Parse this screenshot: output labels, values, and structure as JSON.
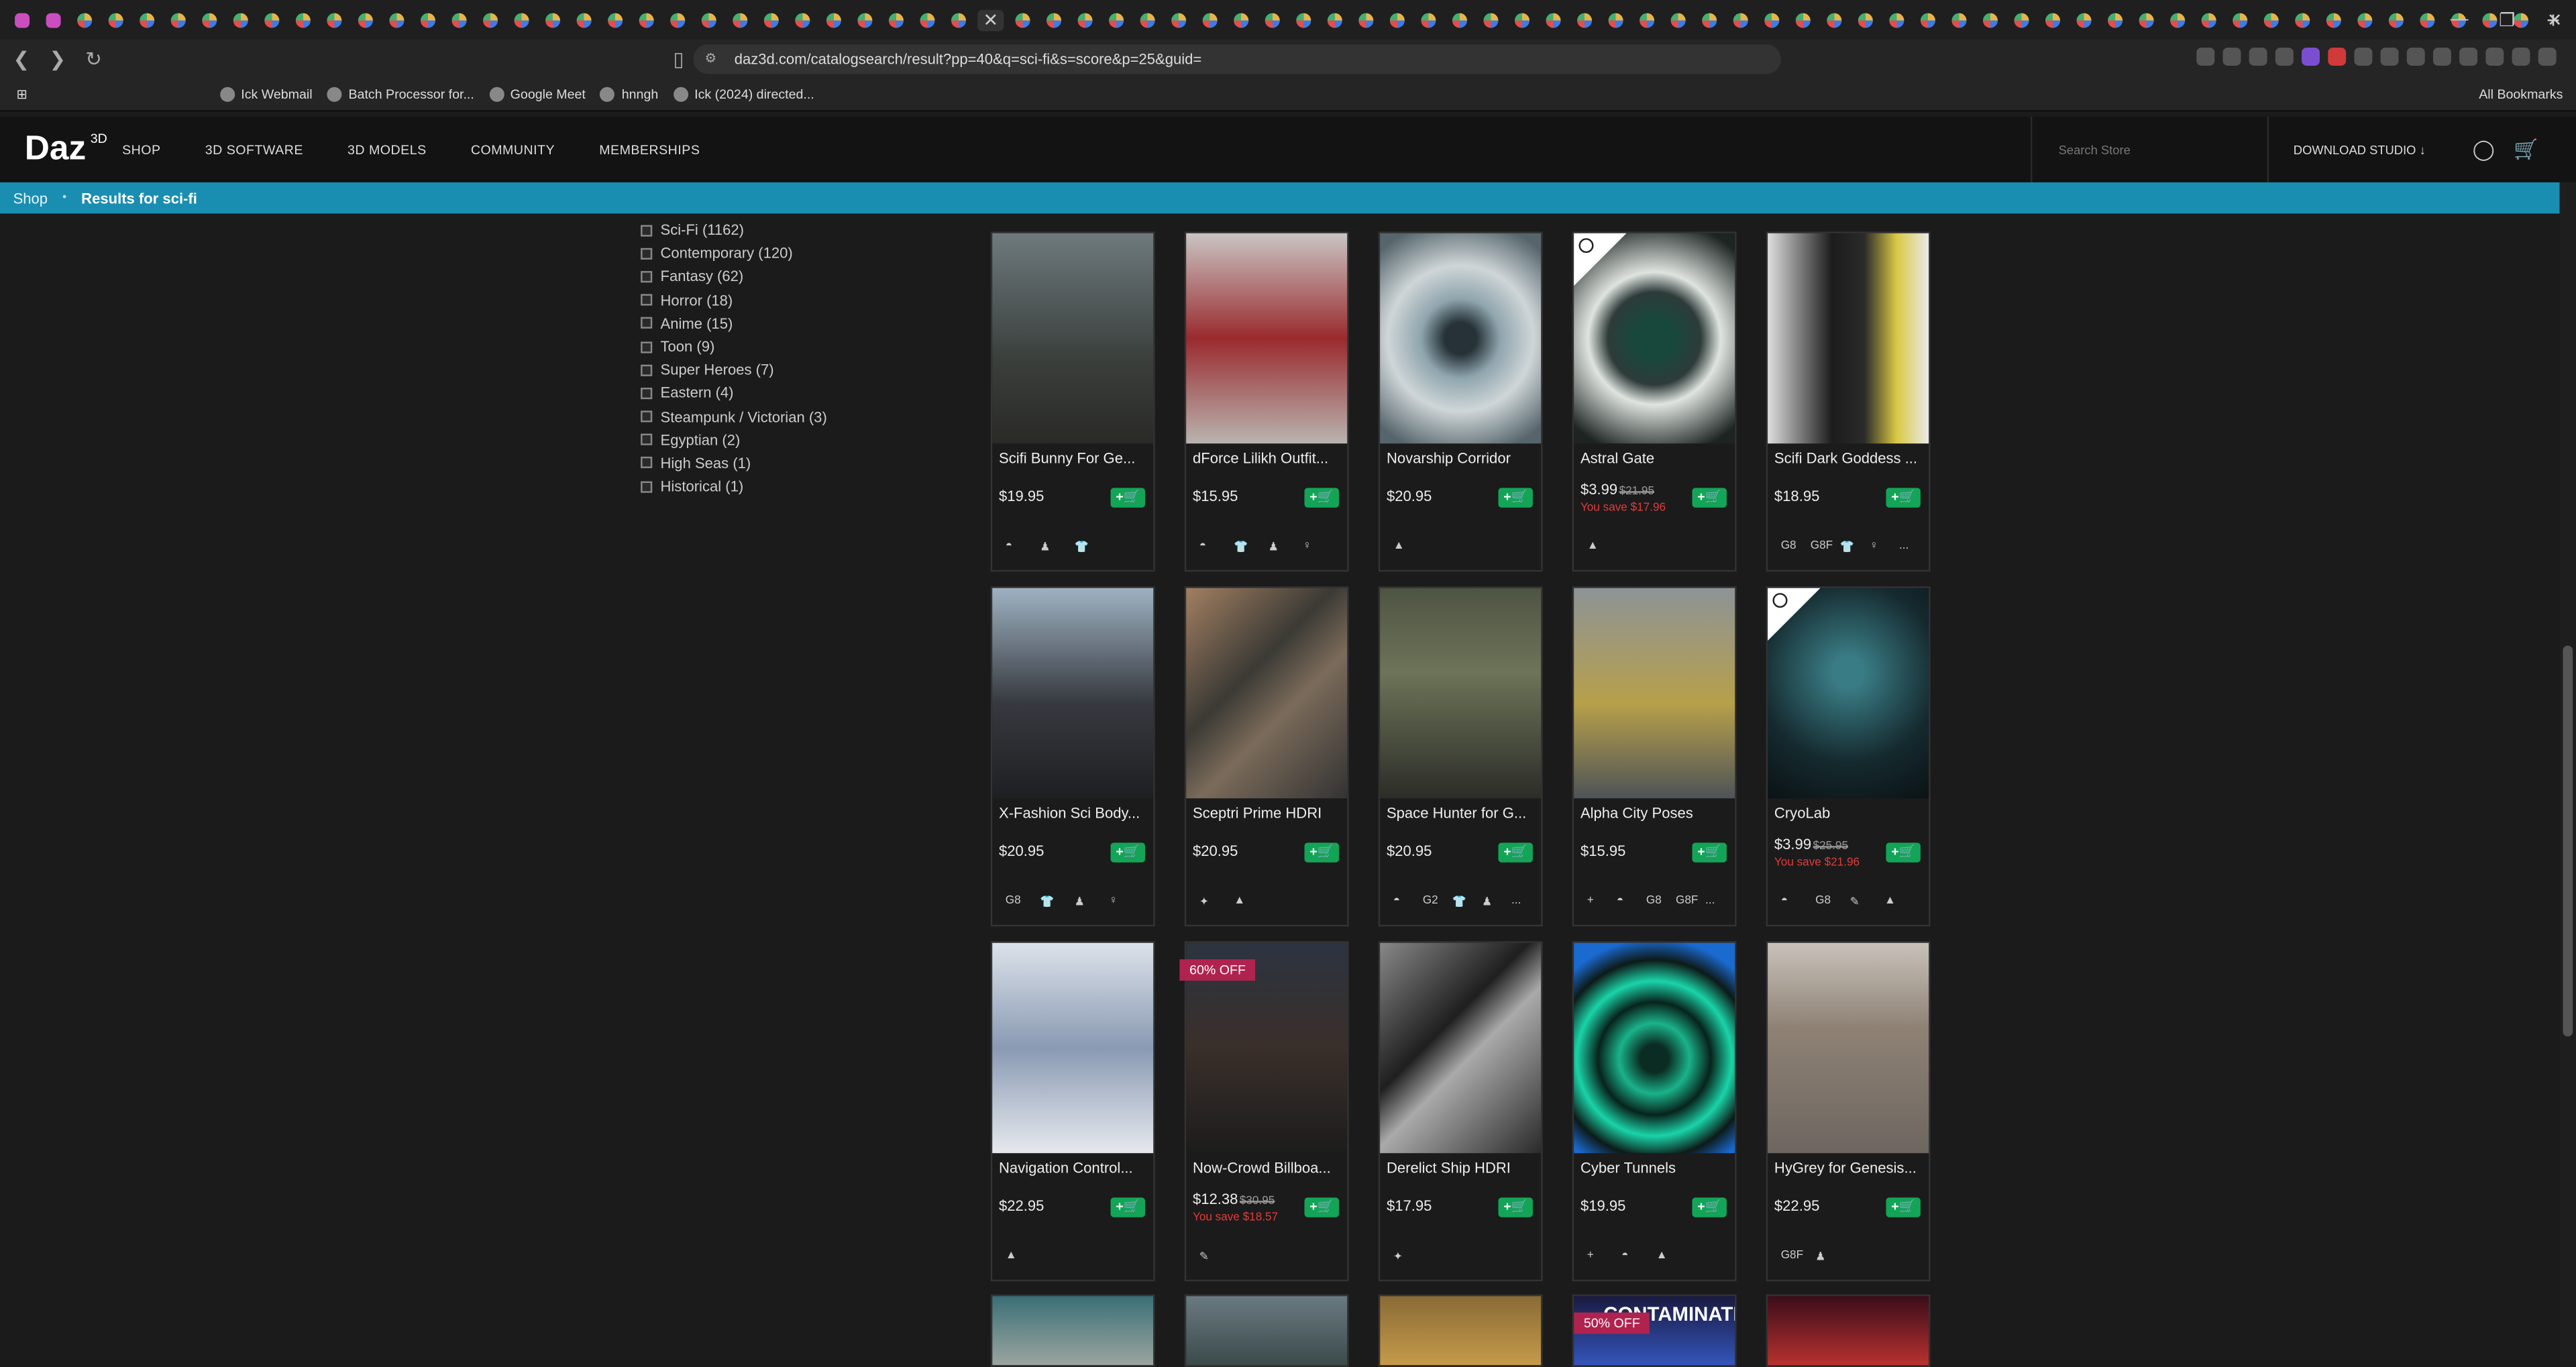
{
  "browser": {
    "url": "daz3d.com/catalogsearch/result?pp=40&q=sci-fi&s=score&p=25&guid=",
    "bookmarks": [
      "Ick Webmail",
      "Batch Processor for...",
      "Google Meet",
      "hnngh",
      "Ick (2024) directed..."
    ],
    "all_bookmarks": "All Bookmarks",
    "tab_close": "✕",
    "new_tab": "+"
  },
  "site": {
    "logo": "Daz",
    "logo_sup": "3D",
    "nav": [
      "SHOP",
      "3D SOFTWARE",
      "3D MODELS",
      "COMMUNITY",
      "MEMBERSHIPS"
    ],
    "search_placeholder": "Search Store",
    "download": "DOWNLOAD STUDIO ↓"
  },
  "breadcrumb": {
    "shop": "Shop",
    "sep": "•",
    "results": "Results for sci-fi"
  },
  "filters": [
    "Sci-Fi (1162)",
    "Contemporary (120)",
    "Fantasy (62)",
    "Horror (18)",
    "Anime (15)",
    "Toon (9)",
    "Super Heroes (7)",
    "Eastern (4)",
    "Steampunk / Victorian (3)",
    "Egyptian (2)",
    "High Seas (1)",
    "Historical (1)"
  ],
  "products": [
    {
      "name": "Scifi Bunny For Ge...",
      "price": "$19.95",
      "icons": [
        "◓",
        "♟",
        "👕"
      ],
      "bg": "linear-gradient(180deg,#6e7a7d,#3a3f3c 60%,#2a2a26)"
    },
    {
      "name": "dForce Lilikh Outfit...",
      "price": "$15.95",
      "icons": [
        "◓",
        "👕",
        "♟",
        "♀"
      ],
      "bg": "linear-gradient(180deg,#c9c6c4,#9a2a2e 50%,#b9b4b0)"
    },
    {
      "name": "Novarship Corridor",
      "price": "$20.95",
      "icons": [
        "▲"
      ],
      "bg": "radial-gradient(circle at 50% 50%,#263238 12%,#8fa5ad 30%,#cfd6d8 55%,#55656b 90%)"
    },
    {
      "name": "Astral Gate",
      "price": "$3.99",
      "old": "$21.95",
      "save": "You save $17.96",
      "icons": [
        "▲"
      ],
      "bg": "radial-gradient(circle at 50% 50%,#18483c 15%,#2e3b39 35%,#dfe4e0 50%,#1d2422 90%)",
      "corner": true
    },
    {
      "name": "Scifi Dark Goddess ...",
      "price": "$18.95",
      "icons": [
        "G8",
        "G8F",
        "👕",
        "♀",
        "..."
      ],
      "bg": "linear-gradient(90deg,#dedede,#1c1c1c 40%,#2a2a2a 60%,#d9c844 80%,#eaeaea)"
    },
    {
      "name": "X-Fashion Sci Body...",
      "price": "$20.95",
      "icons": [
        "G8",
        "👕",
        "♟",
        "♀"
      ],
      "bg": "linear-gradient(180deg,#9fb2c2,#36393f 55%,#1e1f22)"
    },
    {
      "name": "Sceptri Prime HDRI",
      "price": "$20.95",
      "icons": [
        "✦",
        "▲"
      ],
      "bg": "linear-gradient(135deg,#a27f62,#3b3a35 40%,#7b6b5a 60%,#333)"
    },
    {
      "name": "Space Hunter for G...",
      "price": "$20.95",
      "icons": [
        "◓",
        "G2",
        "👕",
        "♟",
        "..."
      ],
      "bg": "linear-gradient(180deg,#4e5443,#6d7458 40%,#2c2d28)"
    },
    {
      "name": "Alpha City Poses",
      "price": "$15.95",
      "icons": [
        "+",
        "◓",
        "G8",
        "G8F",
        "..."
      ],
      "bg": "linear-gradient(180deg,#8d9397,#b7a04a 55%,#4e5357)"
    },
    {
      "name": "CryoLab",
      "price": "$3.99",
      "old": "$25.95",
      "save": "You save $21.96",
      "icons": [
        "◓",
        "G8",
        "✎",
        "▲"
      ],
      "bg": "radial-gradient(circle at 50% 40%,#3a7c85 10%,#152a2f 60%,#0b1214)",
      "corner": true
    },
    {
      "name": "Navigation Control...",
      "price": "$22.95",
      "icons": [
        "▲"
      ],
      "bg": "linear-gradient(180deg,#dce2ea,#8a9ab3 50%,#e6e9ee)"
    },
    {
      "name": "Now-Crowd Billboa...",
      "price": "$12.38",
      "old": "$30.95",
      "save": "You save $18.57",
      "icons": [
        "✎"
      ],
      "bg": "linear-gradient(180deg,#2c3440,#3a2f2a 50%,#1c1c1c)",
      "badge": "60% OFF"
    },
    {
      "name": "Derelict Ship HDRI",
      "price": "$17.95",
      "icons": [
        "✦"
      ],
      "bg": "linear-gradient(135deg,#888,#1f1f1f 40%,#aaa 55%,#2a2a2a)"
    },
    {
      "name": "Cyber Tunnels",
      "price": "$19.95",
      "icons": [
        "+",
        "◓",
        "▲"
      ],
      "bg": "radial-gradient(circle at 50% 55%,#0b2c22 10%,#1ab28a 25%,#08231c 40%,#1ad3a8 55%,#0d1a18 70%,#1a6ad0 85%)"
    },
    {
      "name": "HyGrey for Genesis...",
      "price": "$22.95",
      "icons": [
        "G8F",
        "♟"
      ],
      "bg": "linear-gradient(180deg,#c8c2bb,#8f8275 40%,#6d6660)"
    }
  ],
  "partial_products": [
    {
      "bg": "linear-gradient(180deg,#3a6f76,#9ba5a0)"
    },
    {
      "bg": "linear-gradient(180deg,#6a7a82,#3b4a4a)"
    },
    {
      "bg": "linear-gradient(180deg,#8a6b36,#c59a4a)"
    },
    {
      "bg": "linear-gradient(180deg,#1a1a40,#3355bb)",
      "badge": "50% OFF",
      "title": "CONTAMINATED"
    },
    {
      "bg": "linear-gradient(180deg,#3a0d1a,#b8312e)"
    }
  ]
}
